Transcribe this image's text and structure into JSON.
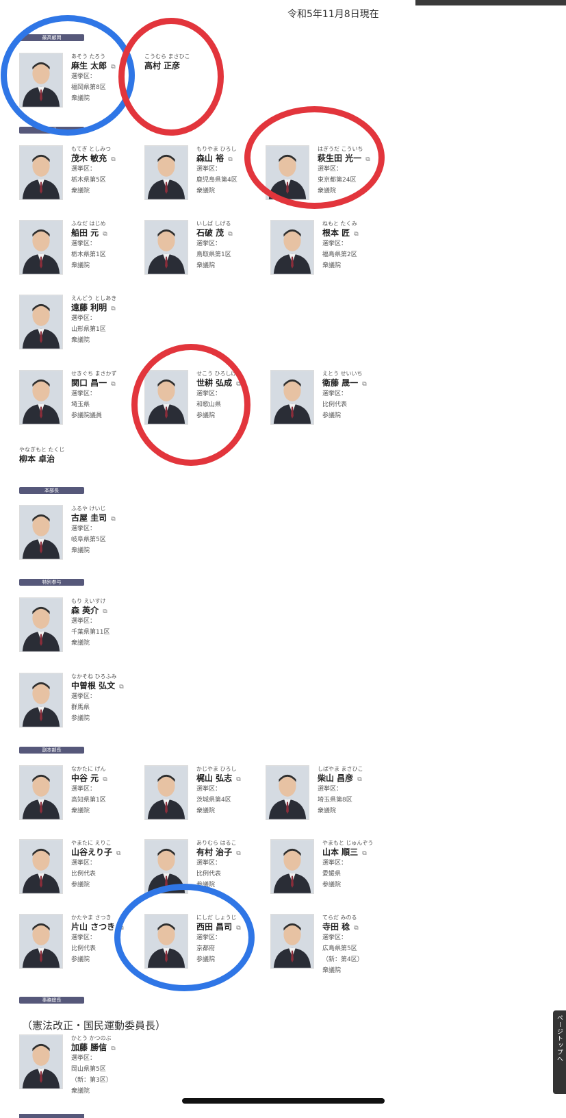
{
  "date": "令和5年11月8日現在",
  "labels": {
    "saiko": "最高顧問",
    "komon": "顧問",
    "honbucho": "本部長",
    "tokubetsu": "特別参与",
    "fukuhonbucho": "副本部長",
    "jimukyokucho": "事務総長"
  },
  "ext_icon": "external-link-icon",
  "members": {
    "aso": {
      "furi": "あそう たろう",
      "name": "麻生 太郎",
      "l1": "選挙区：",
      "l2": "福岡県第8区",
      "l3": "衆議院"
    },
    "takamura": {
      "furi": "こうむら まさひこ",
      "name": "高村 正彦"
    },
    "motegi": {
      "furi": "もてぎ としみつ",
      "name": "茂木 敏充",
      "l1": "選挙区：",
      "l2": "栃木県第5区",
      "l3": "衆議院"
    },
    "moriyama": {
      "furi": "もりやま ひろし",
      "name": "森山 裕",
      "l1": "選挙区：",
      "l2": "鹿児島県第4区",
      "l3": "衆議院"
    },
    "hagiuda": {
      "furi": "はぎうだ こういち",
      "name": "萩生田 光一",
      "l1": "選挙区：",
      "l2": "東京都第24区",
      "l3": "衆議院"
    },
    "funada": {
      "furi": "ふなだ はじめ",
      "name": "船田 元",
      "l1": "選挙区：",
      "l2": "栃木県第1区",
      "l3": "衆議院"
    },
    "ishiba": {
      "furi": "いしば しげる",
      "name": "石破 茂",
      "l1": "選挙区：",
      "l2": "鳥取県第1区",
      "l3": "衆議院"
    },
    "nemoto": {
      "furi": "ねもと たくみ",
      "name": "根本 匠",
      "l1": "選挙区：",
      "l2": "福島県第2区",
      "l3": "衆議院"
    },
    "endo": {
      "furi": "えんどう としあき",
      "name": "遠藤 利明",
      "l1": "選挙区：",
      "l2": "山形県第1区",
      "l3": "衆議院"
    },
    "sekiguchi": {
      "furi": "せきぐち まさかず",
      "name": "関口 昌一",
      "l1": "選挙区：",
      "l2": "埼玉県",
      "l3": "参議院議員"
    },
    "seko": {
      "furi": "せこう ひろしげ",
      "name": "世耕 弘成",
      "l1": "選挙区：",
      "l2": "和歌山県",
      "l3": "参議院"
    },
    "eto": {
      "furi": "えとう せいいち",
      "name": "衛藤 晟一",
      "l1": "選挙区：",
      "l2": "比例代表",
      "l3": "参議院"
    },
    "yanagimoto": {
      "furi": "やなぎもと たくじ",
      "name": "柳本 卓治"
    },
    "furuya": {
      "furi": "ふるや けいじ",
      "name": "古屋 圭司",
      "l1": "選挙区：",
      "l2": "岐阜県第5区",
      "l3": "衆議院"
    },
    "mori": {
      "furi": "もり えいすけ",
      "name": "森 英介",
      "l1": "選挙区：",
      "l2": "千葉県第11区",
      "l3": "衆議院"
    },
    "nakasone": {
      "furi": "なかそね ひろふみ",
      "name": "中曽根 弘文",
      "l1": "選挙区：",
      "l2": "群馬県",
      "l3": "参議院"
    },
    "nakatani": {
      "furi": "なかたに げん",
      "name": "中谷 元",
      "l1": "選挙区：",
      "l2": "高知県第1区",
      "l3": "衆議院"
    },
    "kajiyama": {
      "furi": "かじやま ひろし",
      "name": "梶山 弘志",
      "l1": "選挙区：",
      "l2": "茨城県第4区",
      "l3": "衆議院"
    },
    "shibayama": {
      "furi": "しばやま まさひこ",
      "name": "柴山 昌彦",
      "l1": "選挙区：",
      "l2": "埼玉県第8区",
      "l3": "衆議院"
    },
    "yamatani": {
      "furi": "やまたに えりこ",
      "name": "山谷えり子",
      "l1": "選挙区：",
      "l2": "比例代表",
      "l3": "参議院"
    },
    "arimura": {
      "furi": "ありむら はるこ",
      "name": "有村 治子",
      "l1": "選挙区：",
      "l2": "比例代表",
      "l3": "参議院"
    },
    "yamamoto": {
      "furi": "やまもと じゅんぞう",
      "name": "山本 順三",
      "l1": "選挙区：",
      "l2": "愛媛県",
      "l3": "参議院"
    },
    "katayama": {
      "furi": "かたやま さつき",
      "name": "片山 さつき",
      "l1": "選挙区：",
      "l2": "比例代表",
      "l3": "参議院"
    },
    "nishida": {
      "furi": "にしだ しょうじ",
      "name": "西田 昌司",
      "l1": "選挙区：",
      "l2": "京都府",
      "l3": "参議院"
    },
    "terada": {
      "furi": "てらだ みのる",
      "name": "寺田 稔",
      "l1": "選挙区：",
      "l2": "広島県第5区",
      "l3": "（新：第4区）",
      "l4": "衆議院"
    },
    "kato": {
      "furi": "かとう かつのぶ",
      "name": "加藤 勝信",
      "l1": "選挙区：",
      "l2": "岡山県第5区",
      "l3": "（新：第3区）",
      "l4": "衆議院"
    }
  },
  "note": "（憲法改正・国民運動委員長）",
  "page_top": "ページトップへ",
  "colors": {
    "label_bg": "#56587a",
    "blue_circle": "#2f76e6",
    "red_circle": "#e2353c"
  }
}
